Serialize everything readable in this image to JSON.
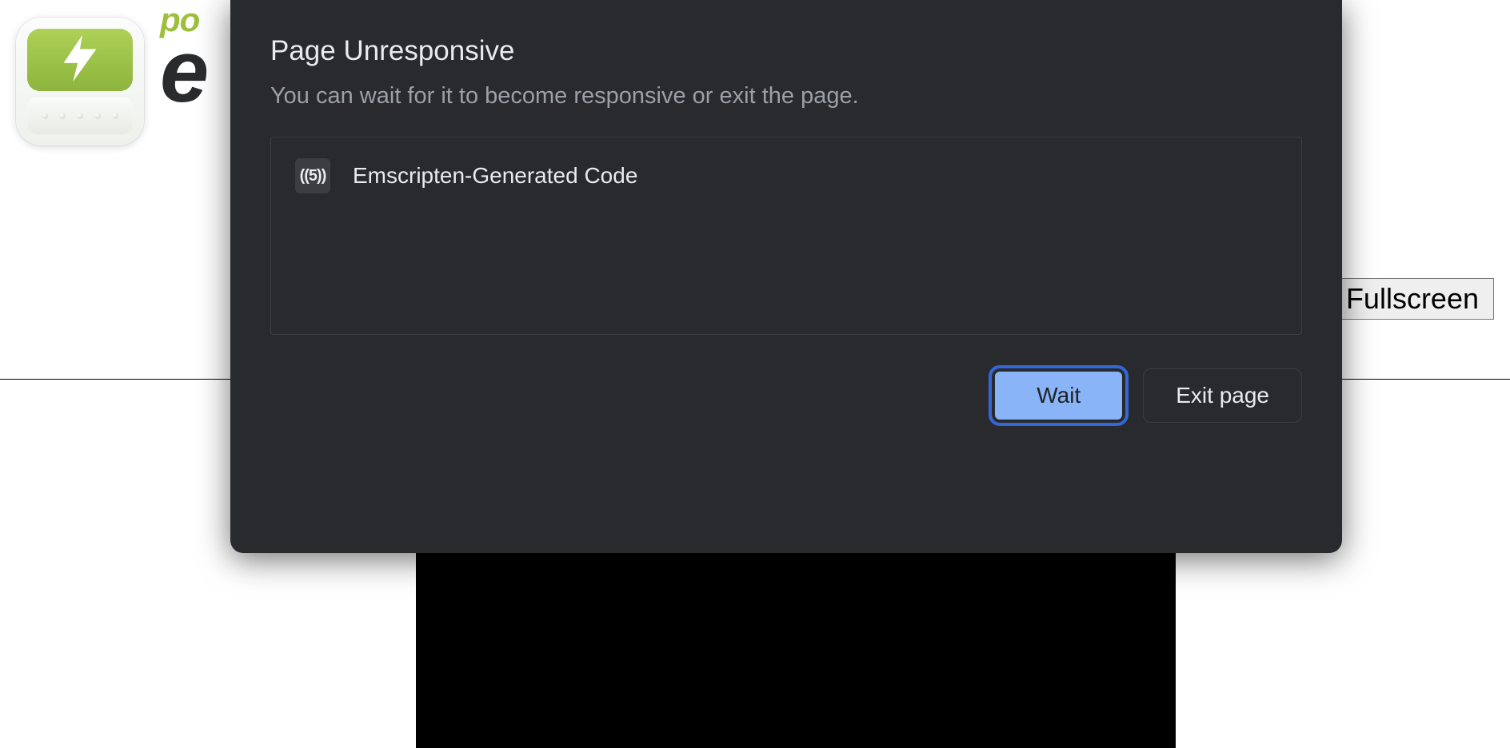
{
  "page": {
    "wordart_line1": "po",
    "wordart_line2": "e",
    "fullscreen_label": "Fullscreen"
  },
  "dialog": {
    "title": "Page Unresponsive",
    "subtitle": "You can wait for it to become responsive or exit the page.",
    "pages": [
      {
        "favicon_text": "((5))",
        "title": "Emscripten-Generated Code"
      }
    ],
    "buttons": {
      "wait": "Wait",
      "exit": "Exit page"
    }
  }
}
